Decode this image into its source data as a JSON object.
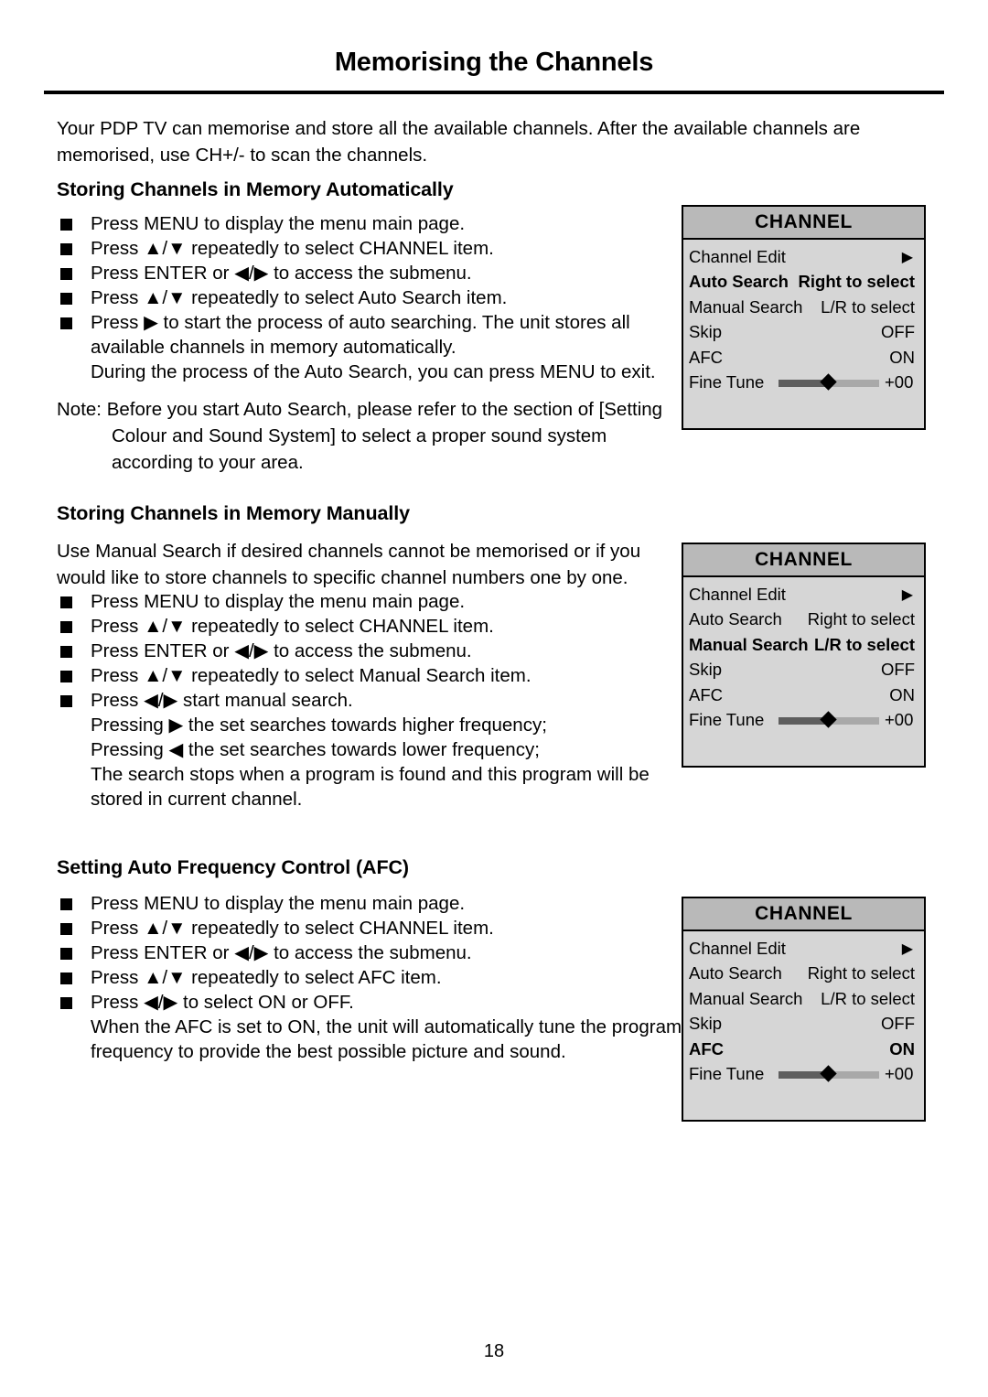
{
  "document": {
    "title": "Memorising the Channels",
    "page_number": "18",
    "intro": "Your PDP TV can memorise and store all the available channels. After the available channels are memorised, use CH+/- to scan the channels."
  },
  "icons": {
    "bullet": "black-square-bullet",
    "up": "▲",
    "down": "▼",
    "left": "◀",
    "right": "▶",
    "slash": "/"
  },
  "sections": [
    {
      "heading": "Storing Channels in Memory Automatically",
      "steps": [
        "Press MENU to display the menu main page.",
        "Press ▲/▼ repeatedly to select CHANNEL item.",
        "Press ENTER or ◀/▶ to access the submenu.",
        "Press ▲/▼ repeatedly to select Auto Search item.",
        "Press ▶ to start the process of auto searching. The unit stores all available channels in memory automatically."
      ],
      "continuation": "During the process of the Auto Search, you can press MENU to exit.",
      "note_label": "Note:",
      "note_text": "Before you start Auto Search, please refer to the section of [Setting Colour and Sound System] to select a proper sound system according to your area."
    },
    {
      "heading": "Storing Channels in Memory Manually",
      "lead": "Use Manual Search if desired channels cannot be memorised or if you would like to store channels to specific channel numbers one by one.",
      "steps": [
        "Press MENU to display the menu main page.",
        "Press ▲/▼ repeatedly to select CHANNEL item.",
        "Press ENTER or ◀/▶ to access the submenu.",
        "Press ▲/▼ repeatedly to select Manual Search item.",
        "Press ◀/▶ start manual search."
      ],
      "continuation_lines": [
        "Pressing ▶ the set searches towards higher frequency;",
        "Pressing ◀ the set searches towards lower frequency;",
        "The search stops when a program is found and this program will be stored in current channel."
      ]
    },
    {
      "heading": "Setting Auto Frequency Control (AFC)",
      "steps": [
        "Press MENU to display the menu main page.",
        "Press ▲/▼ repeatedly to select CHANNEL item.",
        "Press ENTER or ◀/▶ to access the submenu.",
        "Press ▲/▼ repeatedly to select AFC item.",
        "Press ◀/▶ to select ON or OFF."
      ],
      "continuation_lines": [
        "When the AFC is set to ON, the unit will automatically tune the program frequency to provide the best possible picture and sound."
      ]
    }
  ],
  "osd_menus": [
    {
      "title": "CHANNEL",
      "selected": "Auto Search",
      "rows": [
        {
          "label": "Channel Edit",
          "value": "▶",
          "type": "arrow",
          "selected": false
        },
        {
          "label": "Auto Search",
          "value": "Right to select",
          "type": "text",
          "selected": true
        },
        {
          "label": "Manual Search",
          "value": "L/R to select",
          "type": "text",
          "selected": false
        },
        {
          "label": "Skip",
          "value": "OFF",
          "type": "text",
          "selected": false
        },
        {
          "label": "AFC",
          "value": "ON",
          "type": "text",
          "selected": false
        },
        {
          "label": "Fine Tune",
          "value": "+00",
          "type": "slider",
          "selected": false
        }
      ]
    },
    {
      "title": "CHANNEL",
      "selected": "Manual Search",
      "rows": [
        {
          "label": "Channel Edit",
          "value": "▶",
          "type": "arrow",
          "selected": false
        },
        {
          "label": "Auto Search",
          "value": "Right to select",
          "type": "text",
          "selected": false
        },
        {
          "label": "Manual Search",
          "value": "L/R to select",
          "type": "text",
          "selected": true
        },
        {
          "label": "Skip",
          "value": "OFF",
          "type": "text",
          "selected": false
        },
        {
          "label": "AFC",
          "value": "ON",
          "type": "text",
          "selected": false
        },
        {
          "label": "Fine Tune",
          "value": "+00",
          "type": "slider",
          "selected": false
        }
      ]
    },
    {
      "title": "CHANNEL",
      "selected": "AFC",
      "rows": [
        {
          "label": "Channel Edit",
          "value": "▶",
          "type": "arrow",
          "selected": false
        },
        {
          "label": "Auto Search",
          "value": "Right to select",
          "type": "text",
          "selected": false
        },
        {
          "label": "Manual Search",
          "value": "L/R to select",
          "type": "text",
          "selected": false
        },
        {
          "label": "Skip",
          "value": "OFF",
          "type": "text",
          "selected": false
        },
        {
          "label": "AFC",
          "value": "ON",
          "type": "text",
          "selected": true
        },
        {
          "label": "Fine Tune",
          "value": "+00",
          "type": "slider",
          "selected": false
        }
      ]
    }
  ],
  "colors": {
    "osd_title_bg": "#b9b9b9",
    "osd_body_bg": "#d6d6d6",
    "osd_border": "#000000",
    "slider_filled": "#5e5e5e",
    "slider_empty": "#a9a9a9",
    "text": "#000000",
    "page_bg": "#ffffff"
  }
}
